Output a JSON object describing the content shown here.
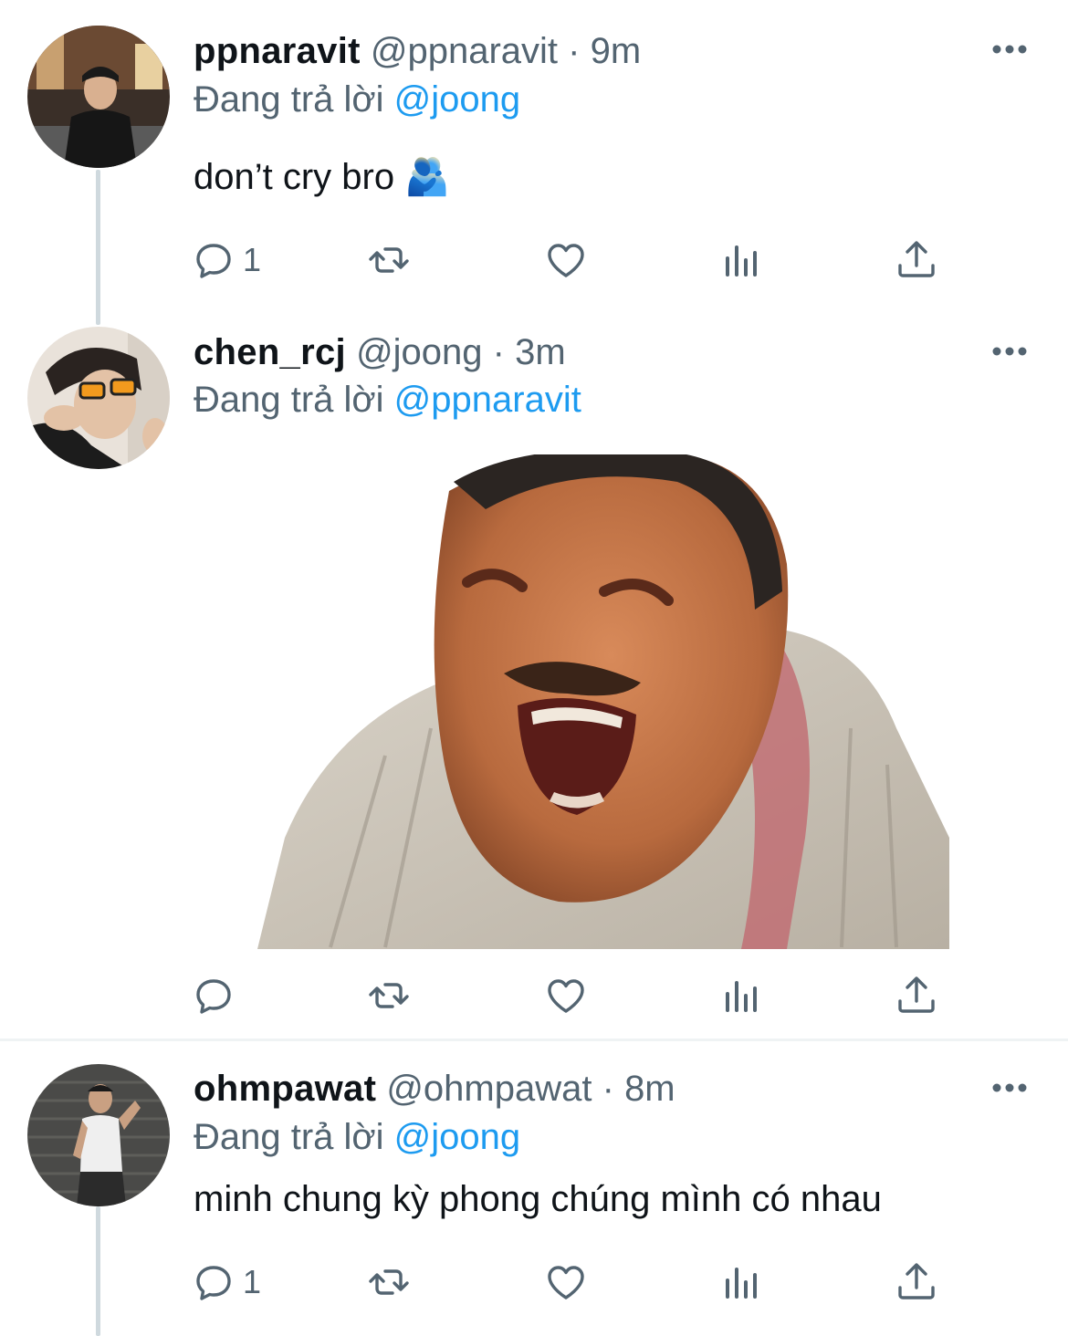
{
  "reply_prefix": "Đang trả lời",
  "tweets": [
    {
      "name": "ppnaravit",
      "handle": "@ppnaravit",
      "time": "9m",
      "reply_to": "@joong",
      "text": "don’t cry bro 🫂",
      "reply_count": "1"
    },
    {
      "name": "chen_rcj",
      "handle": "@joong",
      "time": "3m",
      "reply_to": "@ppnaravit",
      "text": "",
      "reply_count": ""
    },
    {
      "name": "ohmpawat",
      "handle": "@ohmpawat",
      "time": "8m",
      "reply_to": "@joong",
      "text": "minh chung kỳ phong chúng mình có nhau",
      "reply_count": "1"
    }
  ],
  "separator": "·",
  "icons": [
    "reply-icon",
    "retweet-icon",
    "like-icon",
    "analytics-icon",
    "share-icon",
    "more-icon"
  ],
  "colors": {
    "link": "#1d9bf0",
    "secondary": "#536471",
    "text": "#0f1419",
    "line": "#cfd9de"
  }
}
